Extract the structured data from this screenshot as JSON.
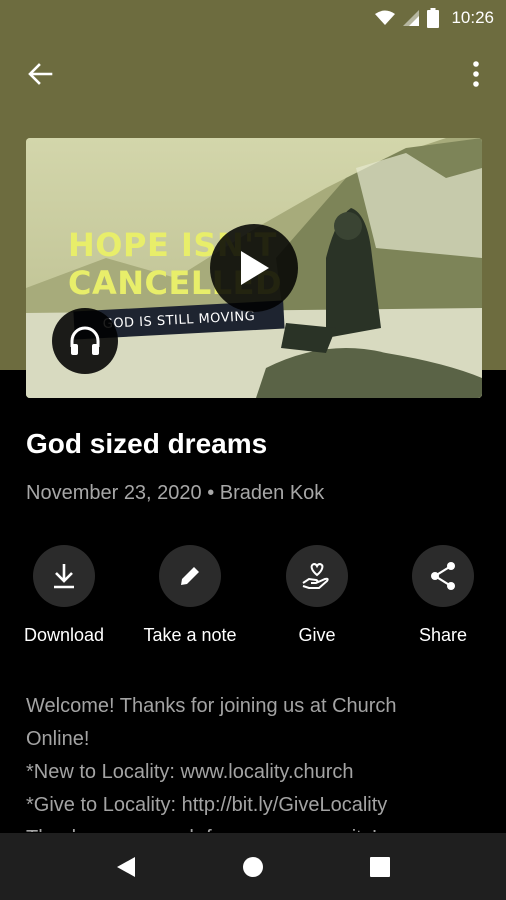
{
  "status_bar": {
    "time": "10:26"
  },
  "app_bar": {
    "back_icon": "arrow-left-icon",
    "more_icon": "more-vert-icon"
  },
  "thumbnail": {
    "headline_line1": "HOPE ISN'T",
    "headline_line2": "CANCELLED",
    "banner": "GOD IS STILL MOVING",
    "play_icon": "play-icon",
    "audio_icon": "headphones-icon"
  },
  "sermon": {
    "title": "God sized dreams",
    "meta": "November 23, 2020 • Braden Kok"
  },
  "actions": [
    {
      "label": "Download",
      "icon": "download-icon"
    },
    {
      "label": "Take a note",
      "icon": "pencil-icon"
    },
    {
      "label": "Give",
      "icon": "give-hand-heart-icon"
    },
    {
      "label": "Share",
      "icon": "share-icon"
    }
  ],
  "description": {
    "lines": [
      "Welcome! Thanks for joining us at Church",
      "Online!",
      "*New to Locality: www.locality.church",
      "*Give to Locality: http://bit.ly/GiveLocality",
      "Thank you so much for your generosity!"
    ]
  },
  "colors": {
    "header_bg": "#6d6c3f",
    "background": "#000000",
    "accent_yellow": "#e8ee6a",
    "nav_bar": "#1f1f1f"
  }
}
